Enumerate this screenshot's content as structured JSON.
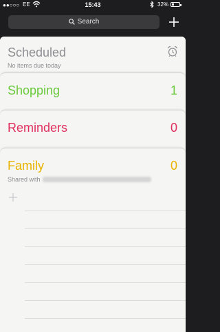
{
  "status_bar": {
    "carrier": "EE",
    "signal_dots": "●●○○○",
    "time": "15:43",
    "battery_pct": "32%",
    "battery_level": 0.32
  },
  "search": {
    "label": "Search"
  },
  "lists": {
    "scheduled": {
      "title": "Scheduled",
      "subtitle": "No items due today"
    },
    "shopping": {
      "title": "Shopping",
      "count": "1",
      "color": "#6bc93c"
    },
    "reminders": {
      "title": "Reminders",
      "count": "0",
      "color": "#e0305f"
    },
    "family": {
      "title": "Family",
      "count": "0",
      "shared_prefix": "Shared with",
      "color": "#e9b300"
    }
  },
  "icons": {
    "add": "plus-icon",
    "search": "search-icon",
    "alarm": "alarm-clock-icon",
    "new_item": "plus-icon"
  }
}
